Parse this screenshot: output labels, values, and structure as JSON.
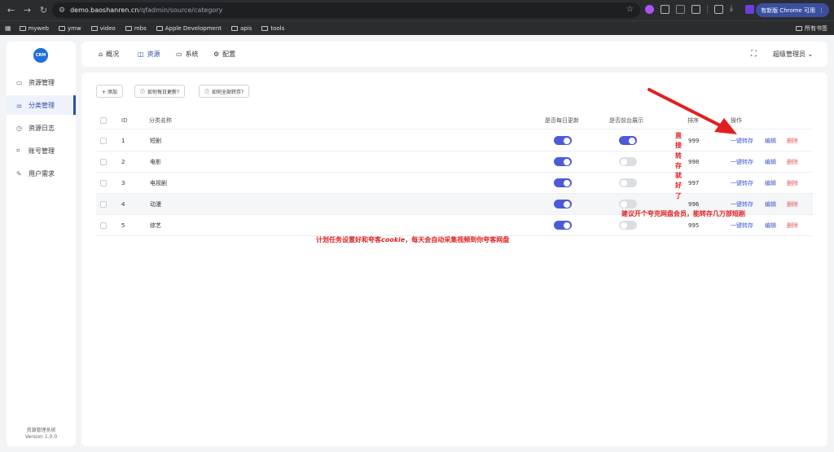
{
  "browser": {
    "url_host": "demo.baoshanren.cn",
    "url_path": "/qfadmin/source/category",
    "update_label": "有新版 Chrome 可用",
    "bookmarks": [
      "myweb",
      "ymw",
      "video",
      "mbs",
      "Apple Development",
      "apis",
      "tools"
    ],
    "all_bookmarks": "所有书签"
  },
  "sidebar": {
    "logo_text": "CRM",
    "items": [
      {
        "label": "资源管理",
        "icon": "folder-icon"
      },
      {
        "label": "分类管理",
        "icon": "sliders-icon",
        "active": true
      },
      {
        "label": "资源日志",
        "icon": "clock-icon"
      },
      {
        "label": "账号管理",
        "icon": "crop-icon"
      },
      {
        "label": "用户需求",
        "icon": "edit-icon"
      }
    ],
    "system_name": "资源管理系统",
    "version": "Version 1.0.0"
  },
  "topnav": {
    "tabs": [
      {
        "label": "概况",
        "icon": "home-icon"
      },
      {
        "label": "资源",
        "icon": "box-icon",
        "active": true
      },
      {
        "label": "系统",
        "icon": "monitor-icon"
      },
      {
        "label": "配置",
        "icon": "gear-icon"
      }
    ],
    "admin": "超级管理员"
  },
  "toolbar": {
    "add": "+ 添加",
    "daily_help": "如何每日更新?",
    "all_help": "如何全部转存?"
  },
  "table": {
    "headers": {
      "id": "ID",
      "name": "分类名称",
      "daily": "是否每日更新",
      "front": "是否前台展示",
      "sort": "排序",
      "ops": "操作"
    },
    "rows": [
      {
        "id": "1",
        "name": "短剧",
        "daily": true,
        "front": true,
        "sort": "999"
      },
      {
        "id": "2",
        "name": "电影",
        "daily": true,
        "front": false,
        "sort": "998"
      },
      {
        "id": "3",
        "name": "电视剧",
        "daily": true,
        "front": false,
        "sort": "997"
      },
      {
        "id": "4",
        "name": "动漫",
        "daily": true,
        "front": false,
        "sort": "996"
      },
      {
        "id": "5",
        "name": "综艺",
        "daily": true,
        "front": false,
        "sort": "995"
      }
    ],
    "action_transfer": "一键转存",
    "action_edit": "编辑",
    "action_delete": "删除"
  },
  "annotations": {
    "vertical": "直接转存就好了",
    "member_tip": "建议开个夸克网盘会员，能转存几万部短剧",
    "cookie_tip_a": "计划任务设置好和夸客",
    "cookie_tip_b": "cookie",
    "cookie_tip_c": "，每天会自动采集视频到你夸客网盘"
  },
  "colors": {
    "accent": "#2d4ea3",
    "toggle_on": "#4d5bd6",
    "link_blue": "#3b57d4",
    "danger": "#e05a5a",
    "annotation": "#e02020"
  }
}
